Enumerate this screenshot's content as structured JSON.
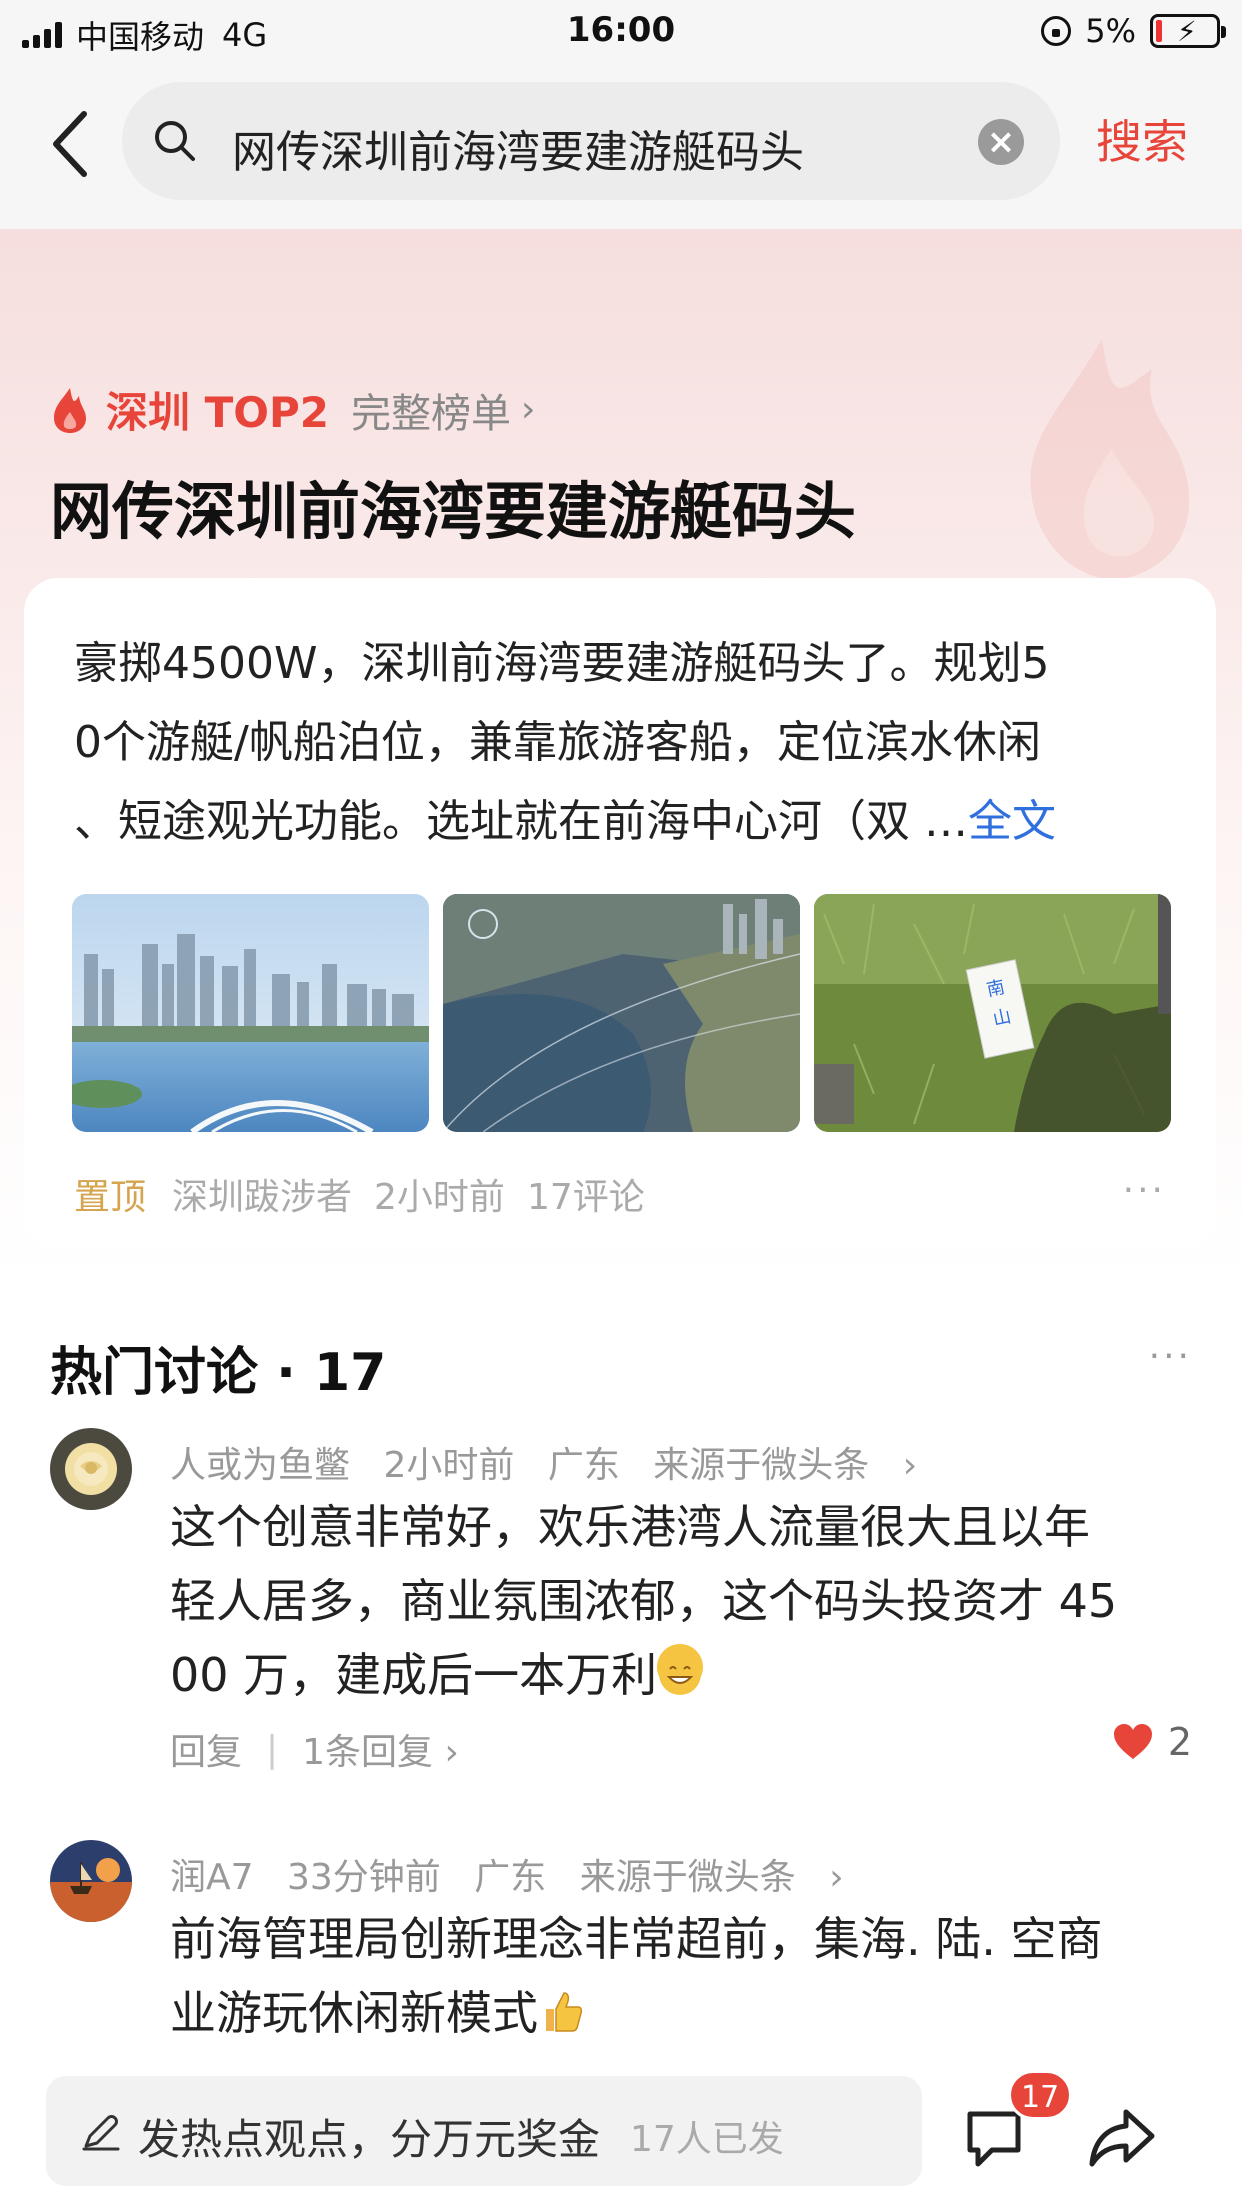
{
  "status_bar": {
    "carrier": "中国移动",
    "network": "4G",
    "time": "16:00",
    "battery": "5%"
  },
  "header": {
    "search_query": "网传深圳前海湾要建游艇码头",
    "search_button": "搜索"
  },
  "hero": {
    "rank_label": "深圳 TOP2",
    "full_list_label": "完整榜单",
    "title": "网传深圳前海湾要建游艇码头"
  },
  "article": {
    "lines": [
      "豪掷4500W，深圳前海湾要建游艇码头了。规划5",
      "0个游艇/帆船泊位，兼靠旅游客船，定位滨水休闲",
      "、短途观光功能。选址就在前海中心河（双 …"
    ],
    "more_label": "全文",
    "pinned_label": "置顶",
    "author": "深圳跋涉者",
    "time": "2小时前",
    "comments": "17评论"
  },
  "discussion": {
    "title": "热门讨论 · 17",
    "comments": [
      {
        "user": "人或为鱼鳖",
        "time": "2小时前",
        "location": "广东",
        "source": "来源于微头条",
        "lines": [
          "这个创意非常好，欢乐港湾人流量很大且以年",
          "轻人居多，商业氛围浓郁，这个码头投资才 45",
          "00 万，建成后一本万利"
        ],
        "reply_label": "回复",
        "replies_label": "1条回复",
        "likes": "2"
      },
      {
        "user": "润A7",
        "time": "33分钟前",
        "location": "广东",
        "source": "来源于微头条",
        "lines": [
          "前海管理局创新理念非常超前，集海. 陆. 空商",
          "业游玩休闲新模式"
        ]
      }
    ]
  },
  "bottom_bar": {
    "post_prompt": "发热点观点，分万元奖金",
    "post_count": "17人已发",
    "comment_badge": "17"
  },
  "colors": {
    "accent_red": "#e8453a",
    "link_blue": "#2f6fde",
    "pinned_gold": "#d6a44f"
  }
}
